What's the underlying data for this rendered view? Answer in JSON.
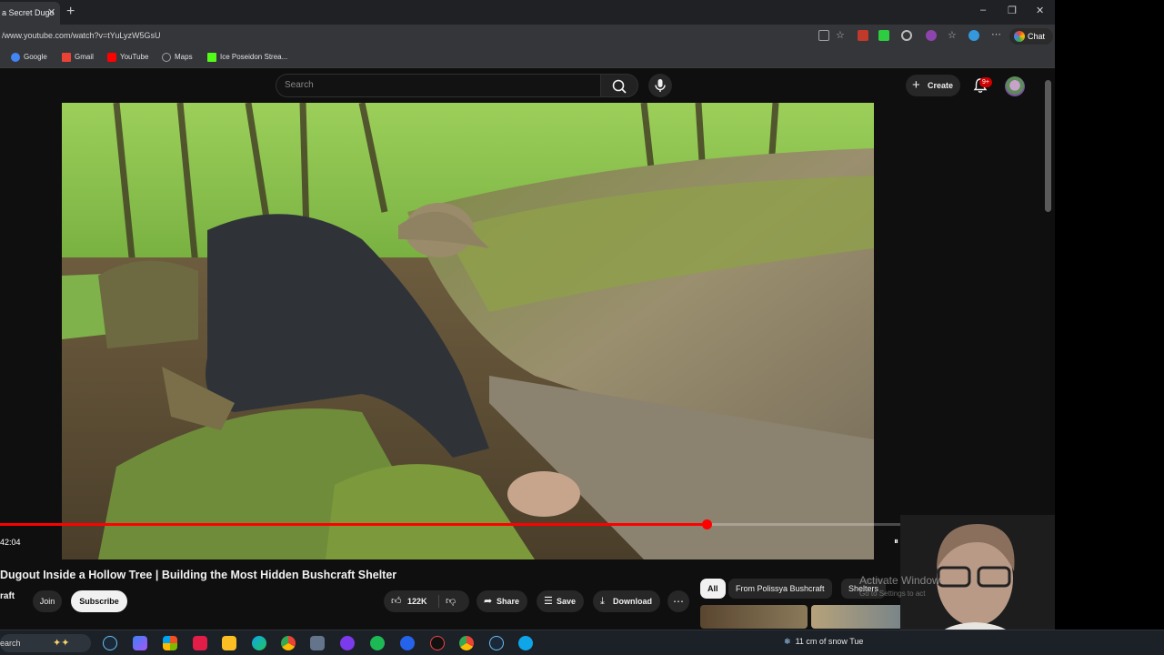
{
  "browser": {
    "tab_title": "a Secret Dugo",
    "new_tab": "+",
    "url": "/www.youtube.com/watch?v=tYuLyzW5GsU",
    "chat_label": "Chat",
    "window_controls": {
      "minimize": "–",
      "restore": "❐",
      "close": "✕"
    },
    "bookmarks": [
      {
        "label": "Google",
        "color": "#4285f4"
      },
      {
        "label": "Gmail",
        "color": "#ea4335"
      },
      {
        "label": "YouTube",
        "color": "#ff0000"
      },
      {
        "label": "Maps",
        "color": "#9aa0a6"
      },
      {
        "label": "Ice Poseidon Strea...",
        "color": "#53fc18"
      }
    ]
  },
  "youtube": {
    "search_placeholder": "Search",
    "create_label": "Create",
    "notification_badge": "9+"
  },
  "player": {
    "progress": 0.683,
    "time_elapsed": "42:04"
  },
  "video": {
    "title": "Dugout Inside a Hollow Tree | Building the Most Hidden Bushcraft Shelter",
    "channel_name": "raft",
    "join_label": "Join",
    "subscribe_label": "Subscribe",
    "like_count": "122K",
    "share_label": "Share",
    "save_label": "Save",
    "download_label": "Download",
    "more_label": "⋯"
  },
  "recommendations": {
    "chips": [
      "All",
      "From Polissya Bushcraft",
      "Shelters"
    ],
    "active_chip": "All"
  },
  "overlay": {
    "activate_title": "Activate Window",
    "activate_sub": "Go to Settings to act"
  },
  "taskbar": {
    "search_label": "earch",
    "weather": "11 cm of snow Tue"
  }
}
